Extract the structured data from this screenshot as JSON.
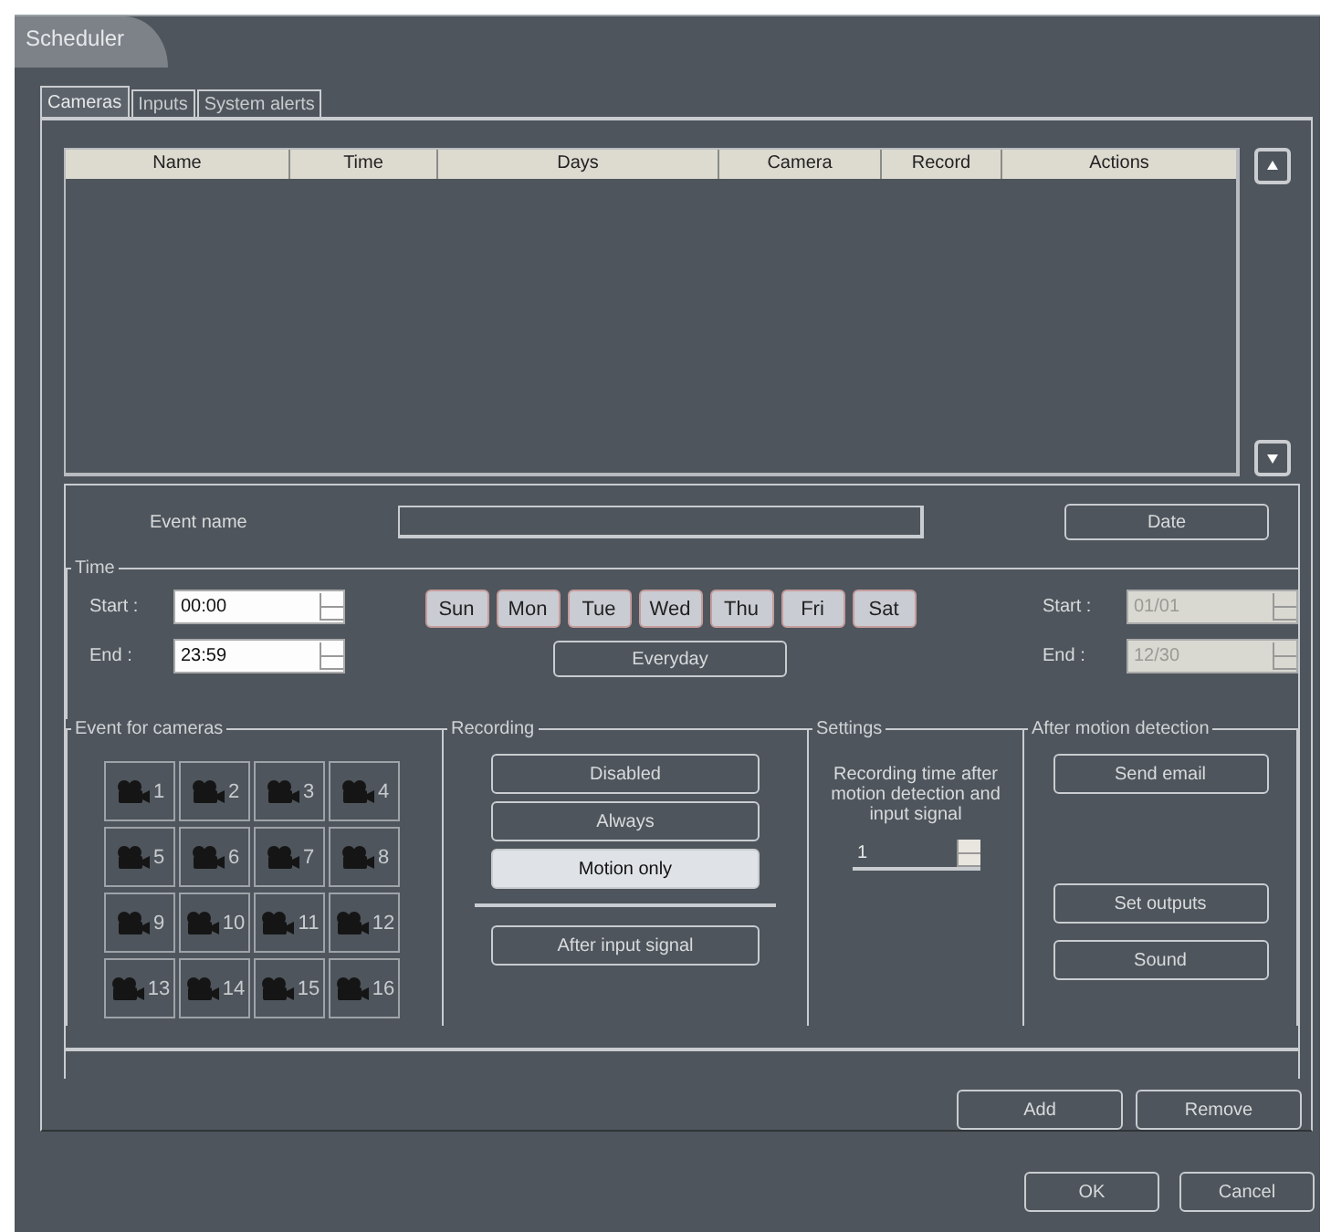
{
  "window": {
    "title": "Scheduler"
  },
  "tabs": [
    {
      "label": "Cameras",
      "selected": true
    },
    {
      "label": "Inputs",
      "selected": false
    },
    {
      "label": "System alerts",
      "selected": false
    }
  ],
  "table": {
    "columns": [
      "Name",
      "Time",
      "Days",
      "Camera",
      "Record",
      "Actions"
    ]
  },
  "event_name": {
    "label": "Event name"
  },
  "date_button": "Date",
  "time": {
    "label": "Time",
    "start": {
      "label": "Start :",
      "value": "00:00"
    },
    "end": {
      "label": "End :",
      "value": "23:59"
    },
    "days": [
      {
        "label": "Sun",
        "selected": true
      },
      {
        "label": "Mon",
        "selected": true
      },
      {
        "label": "Tue",
        "selected": true
      },
      {
        "label": "Wed",
        "selected": true
      },
      {
        "label": "Thu",
        "selected": true
      },
      {
        "label": "Fri",
        "selected": true
      },
      {
        "label": "Sat",
        "selected": true
      }
    ],
    "everyday_button": "Everyday",
    "date_start": {
      "label": "Start :",
      "value": "01/01",
      "disabled": true
    },
    "date_end": {
      "label": "End :",
      "value": "12/30",
      "disabled": true
    }
  },
  "cameras": {
    "label": "Event for cameras",
    "items": [
      {
        "number": "1"
      },
      {
        "number": "2"
      },
      {
        "number": "3"
      },
      {
        "number": "4"
      },
      {
        "number": "5"
      },
      {
        "number": "6"
      },
      {
        "number": "7"
      },
      {
        "number": "8"
      },
      {
        "number": "9"
      },
      {
        "number": "10"
      },
      {
        "number": "11"
      },
      {
        "number": "12"
      },
      {
        "number": "13"
      },
      {
        "number": "14"
      },
      {
        "number": "15"
      },
      {
        "number": "16"
      }
    ]
  },
  "recording": {
    "label": "Recording",
    "options": [
      {
        "label": "Disabled",
        "selected": false
      },
      {
        "label": "Always",
        "selected": false
      },
      {
        "label": "Motion only",
        "selected": true
      }
    ],
    "after_input_signal": "After input signal"
  },
  "settings": {
    "label": "Settings",
    "text": "Recording time after motion detection and input signal",
    "value": "1"
  },
  "after_motion": {
    "label": "After motion detection",
    "buttons": [
      "Send email",
      "Set outputs",
      "Sound"
    ]
  },
  "actions": [
    "Add",
    "Remove"
  ],
  "dialog_buttons": [
    "OK",
    "Cancel"
  ]
}
